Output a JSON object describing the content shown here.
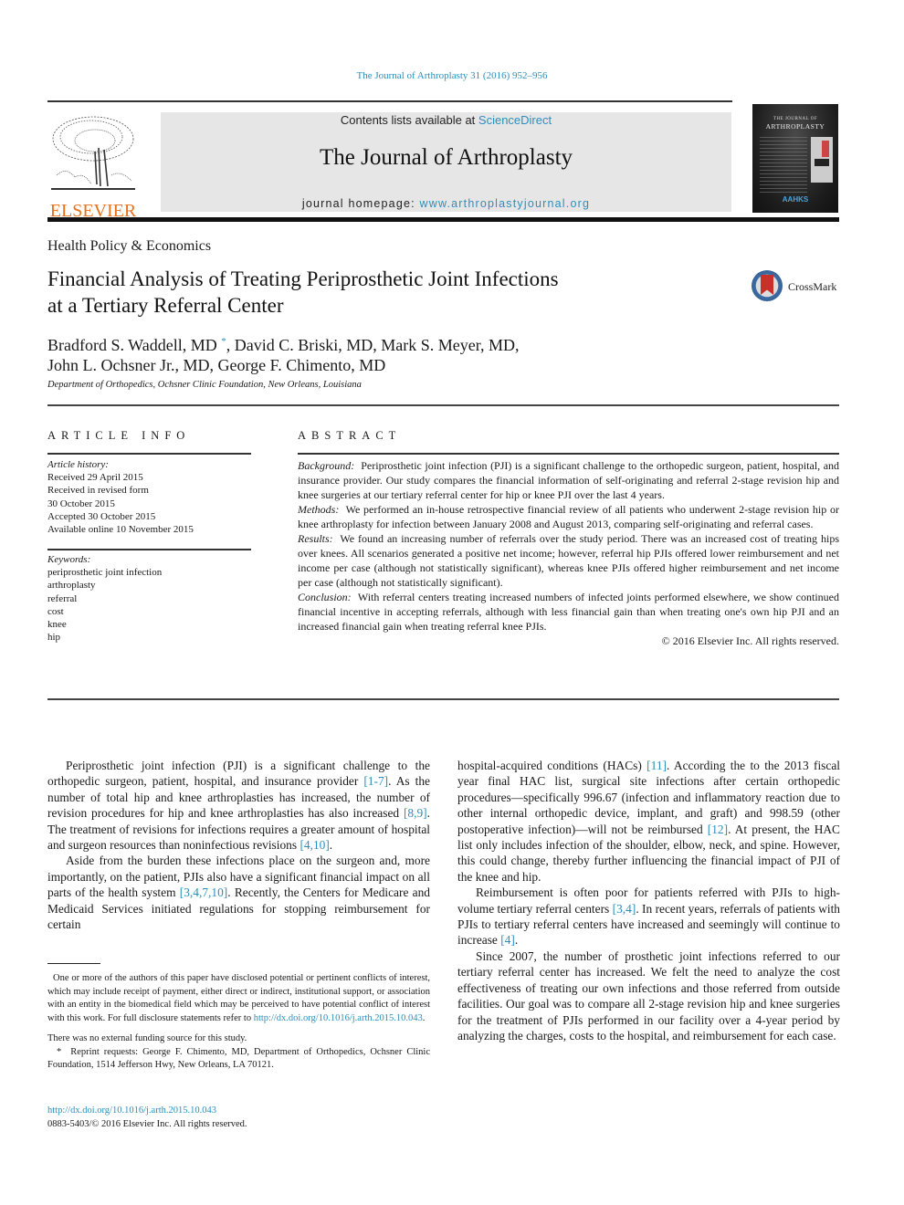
{
  "header": {
    "citation": "The Journal of Arthroplasty 31 (2016) 952–956",
    "publisher_wordmark": "ELSEVIER",
    "contents_prefix": "Contents lists available at ",
    "contents_link": "ScienceDirect",
    "journal_title": "The Journal of Arthroplasty",
    "homepage_prefix": "journal homepage: ",
    "homepage_link": "www.arthroplastyjournal.org",
    "cover": {
      "line1": "THE JOURNAL OF",
      "line2": "ARTHROPLASTY",
      "society": "AAHKS"
    },
    "crossmark_label": "CrossMark"
  },
  "article": {
    "section": "Health Policy & Economics",
    "title_line1": "Financial Analysis of Treating Periprosthetic Joint Infections",
    "title_line2": "at a Tertiary Referral Center",
    "authors_line1_a": "Bradford S. Waddell, MD ",
    "authors_star": "*",
    "authors_line1_b": ", David C. Briski, MD, Mark S. Meyer, MD,",
    "authors_line2": "John L. Ochsner Jr., MD, George F. Chimento, MD",
    "affiliation": "Department of Orthopedics, Ochsner Clinic Foundation, New Orleans, Louisiana"
  },
  "article_info": {
    "heading": "ARTICLE INFO",
    "history_label": "Article history:",
    "history": [
      "Received 29 April 2015",
      "Received in revised form",
      "30 October 2015",
      "Accepted 30 October 2015",
      "Available online 10 November 2015"
    ],
    "keywords_label": "Keywords:",
    "keywords": [
      "periprosthetic joint infection",
      "arthroplasty",
      "referral",
      "cost",
      "knee",
      "hip"
    ]
  },
  "abstract": {
    "heading": "ABSTRACT",
    "background_label": "Background:",
    "background": "Periprosthetic joint infection (PJI) is a significant challenge to the orthopedic surgeon, patient, hospital, and insurance provider. Our study compares the financial information of self-originating and referral 2-stage revision hip and knee surgeries at our tertiary referral center for hip or knee PJI over the last 4 years.",
    "methods_label": "Methods:",
    "methods": "We performed an in-house retrospective financial review of all patients who underwent 2-stage revision hip or knee arthroplasty for infection between January 2008 and August 2013, comparing self-originating and referral cases.",
    "results_label": "Results:",
    "results": "We found an increasing number of referrals over the study period. There was an increased cost of treating hips over knees. All scenarios generated a positive net income; however, referral hip PJIs offered lower reimbursement and net income per case (although not statistically significant), whereas knee PJIs offered higher reimbursement and net income per case (although not statistically significant).",
    "conclusion_label": "Conclusion:",
    "conclusion": "With referral centers treating increased numbers of infected joints performed elsewhere, we show continued financial incentive in accepting referrals, although with less financial gain than when treating one's own hip PJI and an increased financial gain when treating referral knee PJIs.",
    "copyright": "© 2016 Elsevier Inc. All rights reserved."
  },
  "body": {
    "left": {
      "p1_a": "Periprosthetic joint infection (PJI) is a significant challenge to the orthopedic surgeon, patient, hospital, and insurance provider ",
      "p1_ref1": "[1-7]",
      "p1_b": ". As the number of total hip and knee arthroplasties has increased, the number of revision procedures for hip and knee arthroplasties has also increased ",
      "p1_ref2": "[8,9]",
      "p1_c": ". The treatment of revisions for infections requires a greater amount of hospital and surgeon resources than noninfectious revisions ",
      "p1_ref3": "[4,10]",
      "p1_d": ".",
      "p2_a": "Aside from the burden these infections place on the surgeon and, more importantly, on the patient, PJIs also have a significant financial impact on all parts of the health system ",
      "p2_ref1": "[3,4,7,10]",
      "p2_b": ". Recently, the Centers for Medicare and Medicaid Services initiated regulations for stopping reimbursement for certain"
    },
    "right": {
      "p1_a": "hospital-acquired conditions (HACs) ",
      "p1_ref1": "[11]",
      "p1_b": ". According the to the 2013 fiscal year final HAC list, surgical site infections after certain orthopedic procedures—specifically 996.67 (infection and inflammatory reaction due to other internal orthopedic device, implant, and graft) and 998.59 (other postoperative infection)—will not be reimbursed ",
      "p1_ref2": "[12]",
      "p1_c": ". At present, the HAC list only includes infection of the shoulder, elbow, neck, and spine. However, this could change, thereby further influencing the financial impact of PJI of the knee and hip.",
      "p2_a": "Reimbursement is often poor for patients referred with PJIs to high-volume tertiary referral centers ",
      "p2_ref1": "[3,4]",
      "p2_b": ". In recent years, referrals of patients with PJIs to tertiary referral centers have increased and seemingly will continue to increase ",
      "p2_ref2": "[4]",
      "p2_c": ".",
      "p3": "Since 2007, the number of prosthetic joint infections referred to our tertiary referral center has increased. We felt the need to analyze the cost effectiveness of treating our own infections and those referred from outside facilities. Our goal was to compare all 2-stage revision hip and knee surgeries for the treatment of PJIs performed in our facility over a 4-year period by analyzing the charges, costs to the hospital, and reimbursement for each case."
    }
  },
  "footnotes": {
    "coi_a": "One or more of the authors of this paper have disclosed potential or pertinent conflicts of interest, which may include receipt of payment, either direct or indirect, institutional support, or association with an entity in the biomedical field which may be perceived to have potential conflict of interest with this work. For full disclosure statements refer to ",
    "coi_link": "http://dx.doi.org/10.1016/j.arth.2015.10.043",
    "coi_b": ".",
    "funding": "There was no external funding source for this study.",
    "reprint_star": "*",
    "reprint": "Reprint requests: George F. Chimento, MD, Department of Orthopedics, Ochsner Clinic Foundation, 1514 Jefferson Hwy, New Orleans, LA 70121.",
    "doi": "http://dx.doi.org/10.1016/j.arth.2015.10.043",
    "issn": "0883-5403/© 2016 Elsevier Inc. All rights reserved."
  },
  "colors": {
    "link": "#2a8fbf",
    "elsevier_orange": "#e9711c",
    "masthead_bg": "#e6e6e6"
  }
}
